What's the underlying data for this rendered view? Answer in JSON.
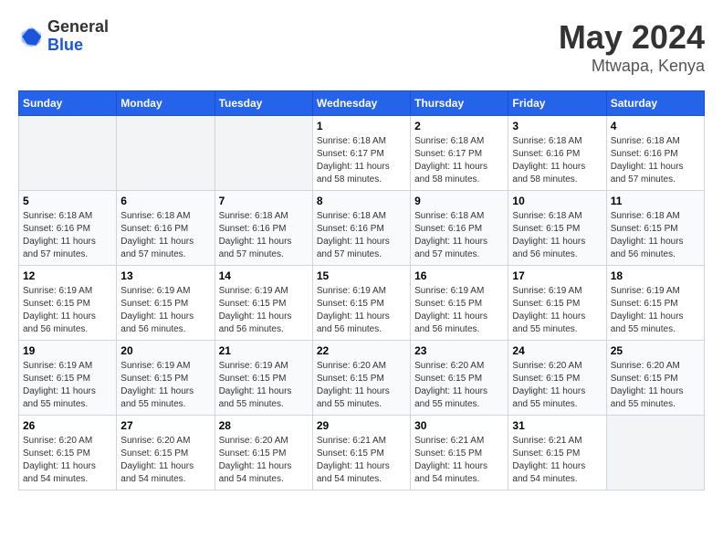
{
  "logo": {
    "general": "General",
    "blue": "Blue"
  },
  "title": {
    "month": "May 2024",
    "location": "Mtwapa, Kenya"
  },
  "weekdays": [
    "Sunday",
    "Monday",
    "Tuesday",
    "Wednesday",
    "Thursday",
    "Friday",
    "Saturday"
  ],
  "weeks": [
    [
      {
        "day": "",
        "info": ""
      },
      {
        "day": "",
        "info": ""
      },
      {
        "day": "",
        "info": ""
      },
      {
        "day": "1",
        "sunrise": "6:18 AM",
        "sunset": "6:17 PM",
        "daylight": "11 hours and 58 minutes."
      },
      {
        "day": "2",
        "sunrise": "6:18 AM",
        "sunset": "6:17 PM",
        "daylight": "11 hours and 58 minutes."
      },
      {
        "day": "3",
        "sunrise": "6:18 AM",
        "sunset": "6:16 PM",
        "daylight": "11 hours and 58 minutes."
      },
      {
        "day": "4",
        "sunrise": "6:18 AM",
        "sunset": "6:16 PM",
        "daylight": "11 hours and 57 minutes."
      }
    ],
    [
      {
        "day": "5",
        "sunrise": "6:18 AM",
        "sunset": "6:16 PM",
        "daylight": "11 hours and 57 minutes."
      },
      {
        "day": "6",
        "sunrise": "6:18 AM",
        "sunset": "6:16 PM",
        "daylight": "11 hours and 57 minutes."
      },
      {
        "day": "7",
        "sunrise": "6:18 AM",
        "sunset": "6:16 PM",
        "daylight": "11 hours and 57 minutes."
      },
      {
        "day": "8",
        "sunrise": "6:18 AM",
        "sunset": "6:16 PM",
        "daylight": "11 hours and 57 minutes."
      },
      {
        "day": "9",
        "sunrise": "6:18 AM",
        "sunset": "6:16 PM",
        "daylight": "11 hours and 57 minutes."
      },
      {
        "day": "10",
        "sunrise": "6:18 AM",
        "sunset": "6:15 PM",
        "daylight": "11 hours and 56 minutes."
      },
      {
        "day": "11",
        "sunrise": "6:18 AM",
        "sunset": "6:15 PM",
        "daylight": "11 hours and 56 minutes."
      }
    ],
    [
      {
        "day": "12",
        "sunrise": "6:19 AM",
        "sunset": "6:15 PM",
        "daylight": "11 hours and 56 minutes."
      },
      {
        "day": "13",
        "sunrise": "6:19 AM",
        "sunset": "6:15 PM",
        "daylight": "11 hours and 56 minutes."
      },
      {
        "day": "14",
        "sunrise": "6:19 AM",
        "sunset": "6:15 PM",
        "daylight": "11 hours and 56 minutes."
      },
      {
        "day": "15",
        "sunrise": "6:19 AM",
        "sunset": "6:15 PM",
        "daylight": "11 hours and 56 minutes."
      },
      {
        "day": "16",
        "sunrise": "6:19 AM",
        "sunset": "6:15 PM",
        "daylight": "11 hours and 56 minutes."
      },
      {
        "day": "17",
        "sunrise": "6:19 AM",
        "sunset": "6:15 PM",
        "daylight": "11 hours and 55 minutes."
      },
      {
        "day": "18",
        "sunrise": "6:19 AM",
        "sunset": "6:15 PM",
        "daylight": "11 hours and 55 minutes."
      }
    ],
    [
      {
        "day": "19",
        "sunrise": "6:19 AM",
        "sunset": "6:15 PM",
        "daylight": "11 hours and 55 minutes."
      },
      {
        "day": "20",
        "sunrise": "6:19 AM",
        "sunset": "6:15 PM",
        "daylight": "11 hours and 55 minutes."
      },
      {
        "day": "21",
        "sunrise": "6:19 AM",
        "sunset": "6:15 PM",
        "daylight": "11 hours and 55 minutes."
      },
      {
        "day": "22",
        "sunrise": "6:20 AM",
        "sunset": "6:15 PM",
        "daylight": "11 hours and 55 minutes."
      },
      {
        "day": "23",
        "sunrise": "6:20 AM",
        "sunset": "6:15 PM",
        "daylight": "11 hours and 55 minutes."
      },
      {
        "day": "24",
        "sunrise": "6:20 AM",
        "sunset": "6:15 PM",
        "daylight": "11 hours and 55 minutes."
      },
      {
        "day": "25",
        "sunrise": "6:20 AM",
        "sunset": "6:15 PM",
        "daylight": "11 hours and 55 minutes."
      }
    ],
    [
      {
        "day": "26",
        "sunrise": "6:20 AM",
        "sunset": "6:15 PM",
        "daylight": "11 hours and 54 minutes."
      },
      {
        "day": "27",
        "sunrise": "6:20 AM",
        "sunset": "6:15 PM",
        "daylight": "11 hours and 54 minutes."
      },
      {
        "day": "28",
        "sunrise": "6:20 AM",
        "sunset": "6:15 PM",
        "daylight": "11 hours and 54 minutes."
      },
      {
        "day": "29",
        "sunrise": "6:21 AM",
        "sunset": "6:15 PM",
        "daylight": "11 hours and 54 minutes."
      },
      {
        "day": "30",
        "sunrise": "6:21 AM",
        "sunset": "6:15 PM",
        "daylight": "11 hours and 54 minutes."
      },
      {
        "day": "31",
        "sunrise": "6:21 AM",
        "sunset": "6:15 PM",
        "daylight": "11 hours and 54 minutes."
      },
      {
        "day": "",
        "info": ""
      }
    ]
  ]
}
